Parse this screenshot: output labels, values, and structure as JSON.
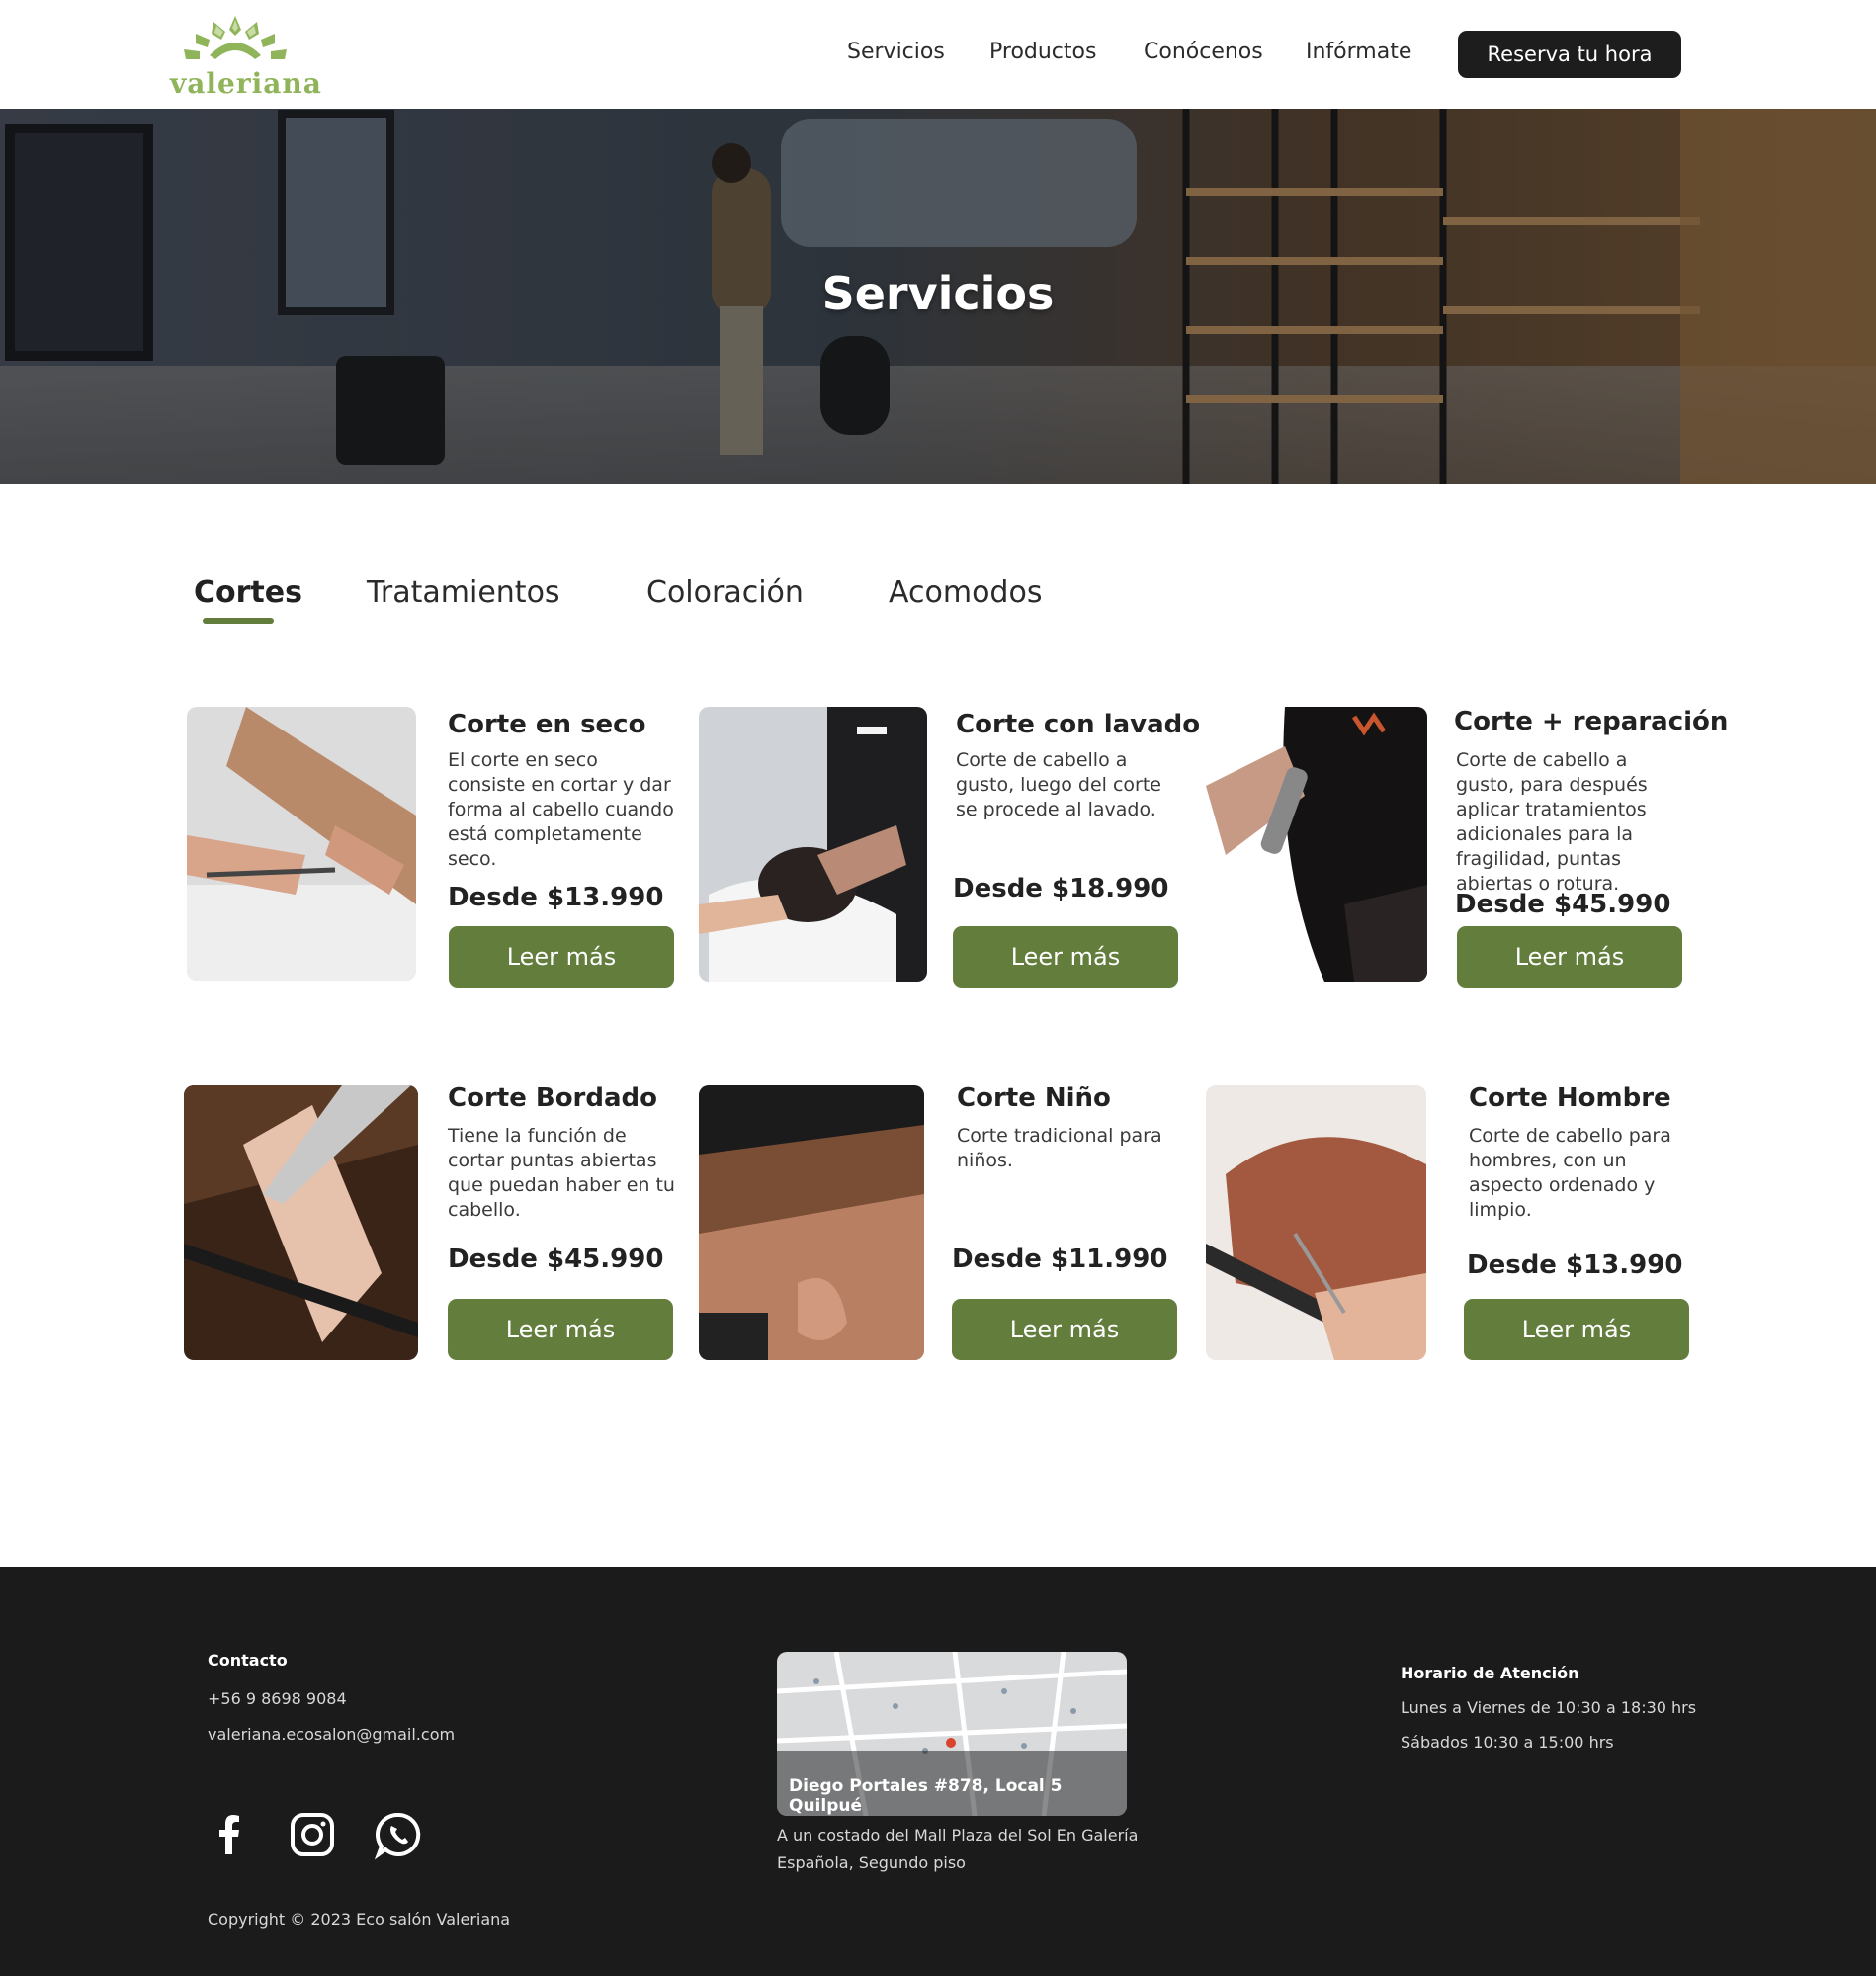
{
  "brand": {
    "logo_text": "valeriana",
    "logo_color": "#8fb45a"
  },
  "nav": {
    "items": [
      "Servicios",
      "Productos",
      "Conócenos",
      "Infórmate"
    ],
    "cta": "Reserva tu hora"
  },
  "hero": {
    "title": "Servicios"
  },
  "tabs": [
    "Cortes",
    "Tratamientos",
    "Coloración",
    "Acomodos"
  ],
  "active_tab": "Cortes",
  "services": [
    {
      "title": "Corte en seco",
      "desc": "El corte en seco consiste en cortar y dar forma al cabello cuando está completamente seco.",
      "price": "Desde $13.990",
      "button": "Leer más"
    },
    {
      "title": "Corte con lavado",
      "desc": "Corte de cabello a gusto, luego del corte se procede al lavado.",
      "price": "Desde $18.990",
      "button": "Leer más"
    },
    {
      "title": "Corte + reparación",
      "desc": "Corte de cabello a gusto, para después aplicar tratamientos adicionales para la fragilidad, puntas abiertas o rotura.",
      "price": "Desde $45.990",
      "button": "Leer más"
    },
    {
      "title": "Corte Bordado",
      "desc": "Tiene la función de cortar puntas abiertas que puedan haber en tu cabello.",
      "price": "Desde $45.990",
      "button": "Leer más"
    },
    {
      "title": "Corte Niño",
      "desc": "Corte tradicional para niños.",
      "price": "Desde $11.990",
      "button": "Leer más"
    },
    {
      "title": "Corte Hombre",
      "desc": "Corte de cabello para hombres, con un aspecto ordenado y limpio.",
      "price": "Desde $13.990",
      "button": "Leer más"
    }
  ],
  "footer": {
    "contact_title": "Contacto",
    "phone": "+56 9 8698 9084",
    "email": "valeriana.ecosalon@gmail.com",
    "social": [
      "facebook-icon",
      "instagram-icon",
      "whatsapp-icon"
    ],
    "address": "Diego Portales #878, Local 5 Quilpué",
    "address_note_1": "A un costado del Mall Plaza del Sol En Galería",
    "address_note_2": "Española, Segundo piso",
    "hours_title": "Horario de Atención",
    "hours_1": "Lunes a Viernes de 10:30 a 18:30 hrs",
    "hours_2": "Sábados 10:30 a 15:00 hrs",
    "copyright": "Copyright © 2023 Eco salón Valeriana"
  },
  "colors": {
    "accent": "#627d3c",
    "dark": "#1b1b1b",
    "cta": "#1d1d1d"
  }
}
